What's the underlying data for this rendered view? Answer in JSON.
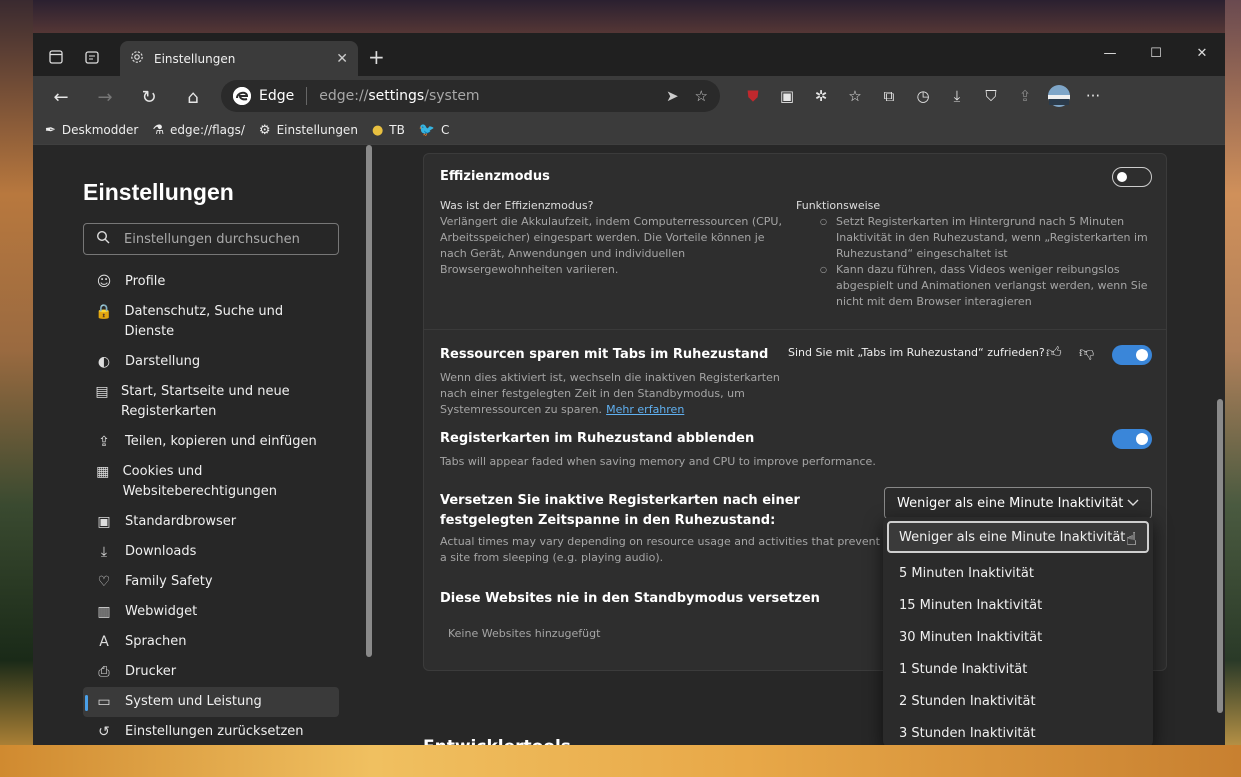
{
  "tab": {
    "title": "Einstellungen"
  },
  "window_controls": {
    "minimize": "—",
    "maximize": "☐",
    "close": "✕"
  },
  "address_bar": {
    "brand": "Edge",
    "url_prefix": "edge://",
    "url_host": "settings",
    "url_path": "/system"
  },
  "bookmarks": [
    {
      "label": "Deskmodder",
      "icon": "pen-icon"
    },
    {
      "label": "edge://flags/",
      "icon": "flask-icon"
    },
    {
      "label": "Einstellungen",
      "icon": "gear-icon"
    },
    {
      "label": "TB",
      "icon": "coin-icon"
    },
    {
      "label": "C",
      "icon": "bird-icon"
    }
  ],
  "sidebar": {
    "title": "Einstellungen",
    "search_placeholder": "Einstellungen durchsuchen",
    "items": [
      {
        "label": "Profile",
        "icon": "profile-icon",
        "glyph": "☺"
      },
      {
        "label": "Datenschutz, Suche und Dienste",
        "icon": "lock-icon",
        "glyph": "🔒"
      },
      {
        "label": "Darstellung",
        "icon": "palette-icon",
        "glyph": "◐"
      },
      {
        "label": "Start, Startseite und neue Registerkarten",
        "icon": "home-grid-icon",
        "glyph": "▤"
      },
      {
        "label": "Teilen, kopieren und einfügen",
        "icon": "share-icon",
        "glyph": "⇪"
      },
      {
        "label": "Cookies und Websiteberechtigungen",
        "icon": "cookie-icon",
        "glyph": "▦"
      },
      {
        "label": "Standardbrowser",
        "icon": "browser-icon",
        "glyph": "▣"
      },
      {
        "label": "Downloads",
        "icon": "download-icon",
        "glyph": "⤓"
      },
      {
        "label": "Family Safety",
        "icon": "family-icon",
        "glyph": "♡"
      },
      {
        "label": "Webwidget",
        "icon": "widget-icon",
        "glyph": "▥"
      },
      {
        "label": "Sprachen",
        "icon": "language-icon",
        "glyph": "A"
      },
      {
        "label": "Drucker",
        "icon": "printer-icon",
        "glyph": "⎙"
      },
      {
        "label": "System und Leistung",
        "icon": "laptop-icon",
        "glyph": "▭"
      },
      {
        "label": "Einstellungen zurücksetzen",
        "icon": "reset-icon",
        "glyph": "↺"
      }
    ],
    "active_index": 12
  },
  "efficiency": {
    "title": "Effizienzmodus",
    "toggle_on": false,
    "what_heading": "Was ist der Effizienzmodus?",
    "what_text": "Verlängert die Akkulaufzeit, indem Computerressourcen (CPU, Arbeitsspeicher) eingespart werden. Die Vorteile können je nach Gerät, Anwendungen und individuellen Browsergewohnheiten variieren.",
    "how_heading": "Funktionsweise",
    "how_bullets": [
      "Setzt Registerkarten im Hintergrund nach 5 Minuten Inaktivität in den Ruhezustand, wenn „Registerkarten im Ruhezustand“ eingeschaltet ist",
      "Kann dazu führen, dass Videos weniger reibungslos abgespielt und Animationen verlangst werden, wenn Sie nicht mit dem Browser interagieren"
    ]
  },
  "sleeping_tabs": {
    "title": "Ressourcen sparen mit Tabs im Ruhezustand",
    "desc": "Wenn dies aktiviert ist, wechseln die inaktiven Registerkarten nach einer festgelegten Zeit in den Standbymodus, um Systemressourcen zu sparen.",
    "link": "Mehr erfahren",
    "feedback": "Sind Sie mit „Tabs im Ruhezustand“ zufrieden?",
    "toggle_on": true
  },
  "fade": {
    "title": "Registerkarten im Ruhezustand abblenden",
    "desc": "Tabs will appear faded when saving memory and CPU to improve performance.",
    "toggle_on": true
  },
  "timeout": {
    "title": "Versetzen Sie inaktive Registerkarten nach einer festgelegten Zeitspanne in den Ruhezustand:",
    "desc": "Actual times may vary depending on resource usage and activities that prevent a site from sleeping (e.g. playing audio).",
    "selected": "Weniger als eine Minute Inaktivität",
    "options": [
      "Weniger als eine Minute Inaktivität",
      "5 Minuten Inaktivität",
      "15 Minuten Inaktivität",
      "30 Minuten Inaktivität",
      "1 Stunde Inaktivität",
      "2 Stunden Inaktivität",
      "3 Stunden Inaktivität"
    ]
  },
  "never_sleep": {
    "title": "Diese Websites nie in den Standbymodus versetzen",
    "empty": "Keine Websites hinzugefügt"
  },
  "next_section_partial": "Entwicklertools"
}
